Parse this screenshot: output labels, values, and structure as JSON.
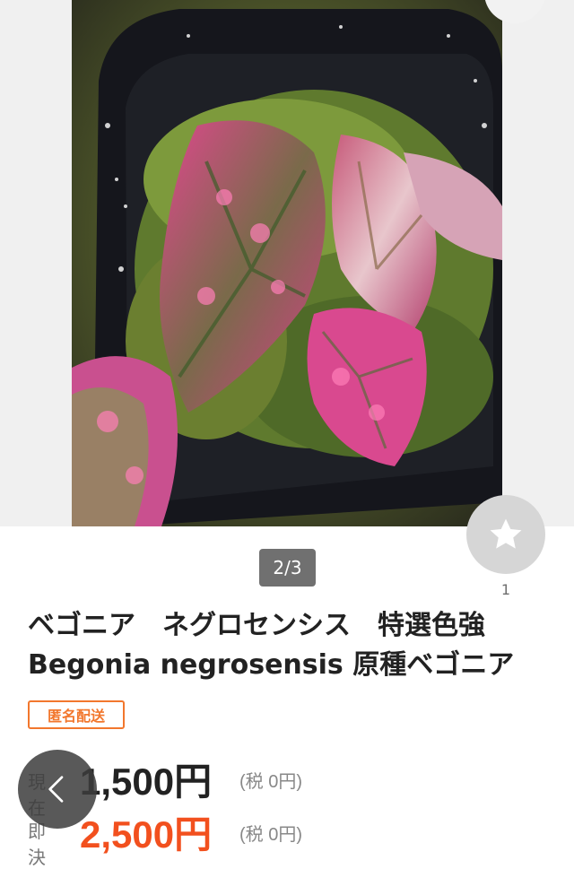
{
  "gallery": {
    "position_text": "2/3",
    "favorite_count": "1",
    "photo_alt": "Begonia negrosensis plant in a black pot"
  },
  "item": {
    "title": "ベゴニア　ネグロセンシス　特選色強\nBegonia negrosensis 原種ベゴニア",
    "badge": "匿名配送"
  },
  "prices": {
    "current": {
      "label": "現在",
      "value": "1,500円",
      "tax": "(税 0円)"
    },
    "buy_now": {
      "label": "即決",
      "value": "2,500円",
      "tax": "(税 0円)"
    }
  },
  "colors": {
    "accent": "#f2772d",
    "buy_now_price": "#f2501e",
    "favorite_button": "#d6d6d6",
    "back_button": "#3c3c3c"
  },
  "icons": {
    "favorite": "star-icon",
    "back": "chevron-left-icon"
  }
}
